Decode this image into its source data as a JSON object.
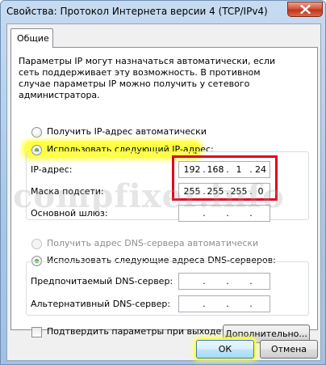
{
  "window": {
    "title": "Свойства: Протокол Интернета версии 4 (TCP/IPv4)"
  },
  "tabs": [
    {
      "label": "Общие"
    }
  ],
  "description": "Параметры IP могут назначаться автоматически, если сеть поддерживает эту возможность. В противном случае параметры IP можно получить у сетевого администратора.",
  "ip_section": {
    "radio_auto_label": "Получить IP-адрес автоматически",
    "radio_manual_label": "Использовать следующий IP-адрес:",
    "ip_address": {
      "label": "IP-адрес:",
      "octets": [
        "192",
        "168",
        "1",
        "24"
      ]
    },
    "subnet_mask": {
      "label": "Маска подсети:",
      "octets": [
        "255",
        "255",
        "255",
        "0"
      ]
    },
    "gateway": {
      "label": "Основной шлюз:",
      "octets": [
        "",
        "",
        "",
        ""
      ]
    }
  },
  "dns_section": {
    "radio_auto_label": "Получить адрес DNS-сервера автоматически",
    "radio_manual_label": "Использовать следующие адреса DNS-серверов:",
    "preferred": {
      "label": "Предпочитаемый DNS-сервер:",
      "octets": [
        "",
        "",
        "",
        ""
      ]
    },
    "alternate": {
      "label": "Альтернативный DNS-сервер:",
      "octets": [
        "",
        "",
        "",
        ""
      ]
    }
  },
  "validate_label": "Подтвердить параметры при выходе",
  "buttons": {
    "advanced": "Дополнительно...",
    "ok": "ОК",
    "cancel": "Отмена"
  },
  "watermark": "compfixer.info",
  "colors": {
    "highlight": "#ffff44",
    "red_frame": "#e0061e",
    "title_bar": "#b9d1ea"
  }
}
